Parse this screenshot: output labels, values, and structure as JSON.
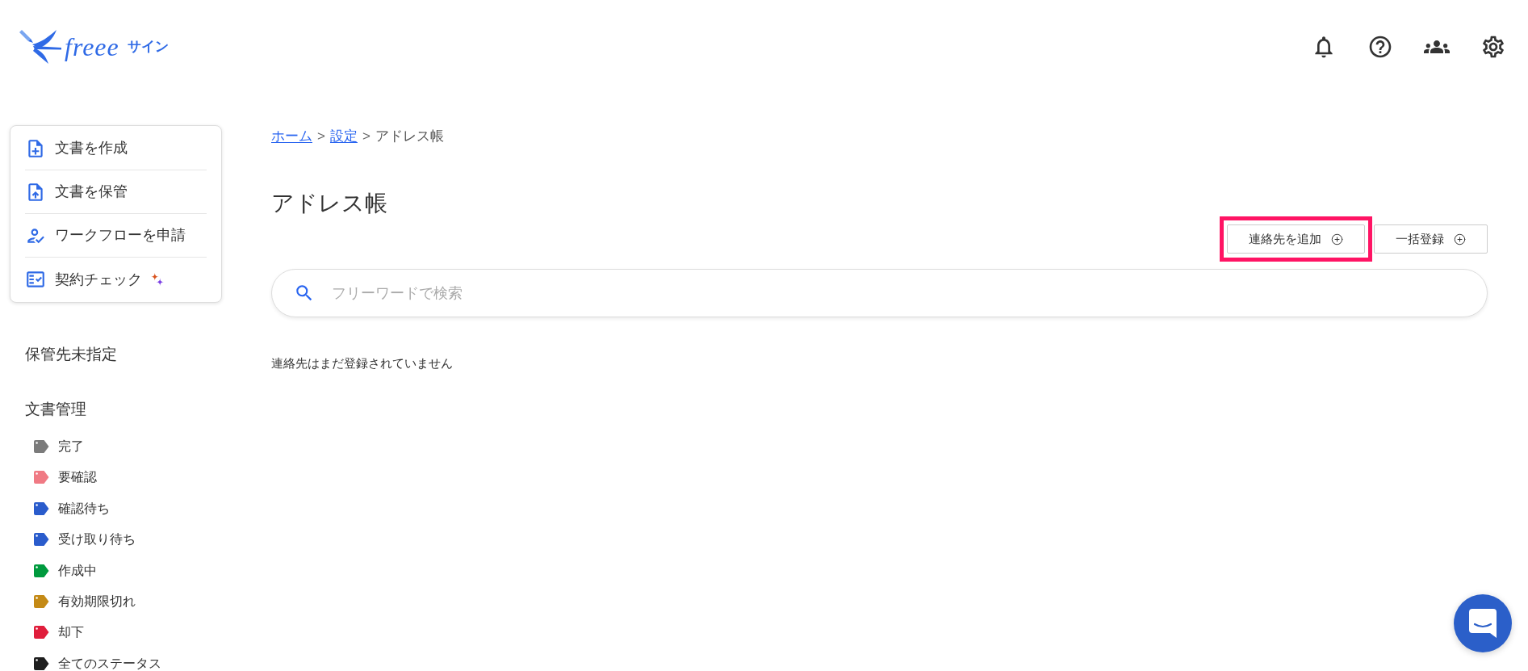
{
  "logo": {
    "brand": "freee",
    "product": "サイン"
  },
  "sidebar": {
    "menu": [
      {
        "label": "文書を作成"
      },
      {
        "label": "文書を保管"
      },
      {
        "label": "ワークフローを申請"
      },
      {
        "label": "契約チェック"
      }
    ],
    "unassigned": "保管先未指定",
    "section_title": "文書管理",
    "tags": [
      {
        "label": "完了",
        "color": "#7b7b7b"
      },
      {
        "label": "要確認",
        "color": "#f07a84"
      },
      {
        "label": "確認待ち",
        "color": "#2a5ccc"
      },
      {
        "label": "受け取り待ち",
        "color": "#2a5ccc"
      },
      {
        "label": "作成中",
        "color": "#009a3e"
      },
      {
        "label": "有効期限切れ",
        "color": "#c48a16"
      },
      {
        "label": "却下",
        "color": "#e01e3c"
      },
      {
        "label": "全てのステータス",
        "color": "#1e1e1e"
      }
    ]
  },
  "breadcrumb": [
    {
      "label": "ホーム",
      "kind": "link"
    },
    {
      "label": ">",
      "kind": "separator"
    },
    {
      "label": "設定",
      "kind": "link"
    },
    {
      "label": ">",
      "kind": "separator"
    },
    {
      "label": "アドレス帳",
      "kind": "current"
    }
  ],
  "page_title": "アドレス帳",
  "actions": [
    {
      "label": "連絡先を追加",
      "highlighted": true
    },
    {
      "label": "一括登録",
      "highlighted": false
    }
  ],
  "search": {
    "placeholder": "フリーワードで検索"
  },
  "empty_message": "連絡先はまだ登録されていません"
}
